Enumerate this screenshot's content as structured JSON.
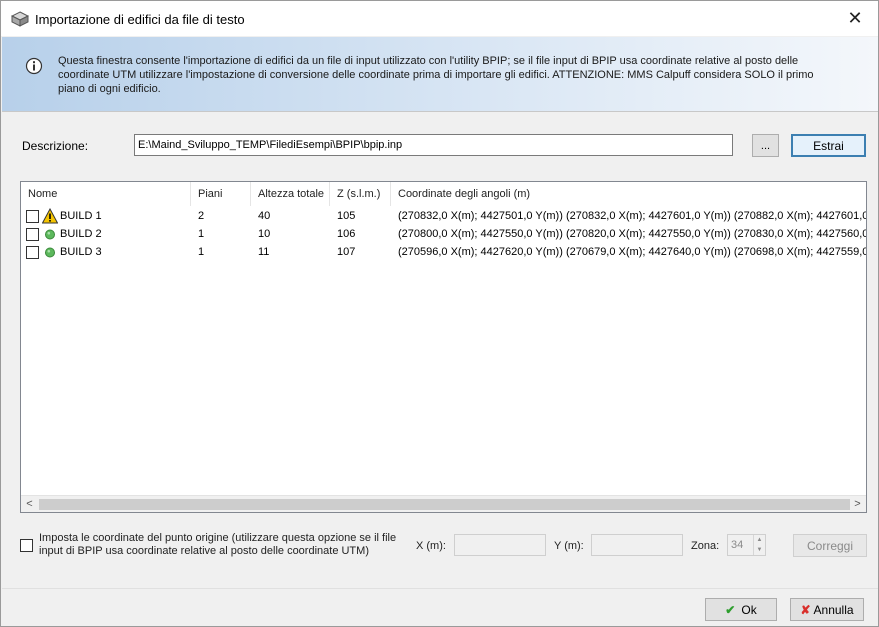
{
  "window": {
    "title": "Importazione di edifici da file di testo",
    "close_glyph": "✕"
  },
  "info": {
    "icon": "info-icon",
    "text": "Questa finestra consente l'importazione di edifici da un file di input utilizzato con l'utility BPIP; se il file input di BPIP usa coordinate relative al posto delle coordinate UTM utilizzare l'impostazione di conversione delle coordinate  prima di importare gli edifici. ATTENZIONE: MMS Calpuff considera SOLO il primo piano di ogni edificio."
  },
  "descrizione": {
    "label": "Descrizione:",
    "value": "E:\\Maind_Sviluppo_TEMP\\FilediEsempi\\BPIP\\bpip.inp",
    "browse_label": "...",
    "extract_label": "Estrai"
  },
  "table": {
    "columns": [
      "Nome",
      "Piani",
      "Altezza totale",
      "Z (s.l.m.)",
      "Coordinate degli angoli (m)"
    ],
    "rows": [
      {
        "name": "BUILD 1",
        "status": "warning",
        "piani": "2",
        "altezza": "40",
        "z": "105",
        "coords": "(270832,0 X(m); 4427501,0 Y(m)) (270832,0 X(m); 4427601,0 Y(m)) (270882,0 X(m); 4427601,0 ..."
      },
      {
        "name": "BUILD 2",
        "status": "ok",
        "piani": "1",
        "altezza": "10",
        "z": "106",
        "coords": "(270800,0 X(m); 4427550,0 Y(m)) (270820,0 X(m); 4427550,0 Y(m)) (270830,0 X(m); 4427560,0 ..."
      },
      {
        "name": "BUILD 3",
        "status": "ok",
        "piani": "1",
        "altezza": "11",
        "z": "107",
        "coords": "(270596,0 X(m); 4427620,0 Y(m)) (270679,0 X(m); 4427640,0 Y(m)) (270698,0 X(m); 4427559,0 ..."
      }
    ],
    "scroll_left": "<",
    "scroll_right": ">"
  },
  "origin": {
    "label": "Imposta le coordinate del punto origine (utilizzare questa opzione se il file input di BPIP usa coordinate relative al posto delle coordinate UTM)",
    "x_label": "X (m):",
    "y_label": "Y (m):",
    "zona_label": "Zona:",
    "zona_value": "34",
    "correggi_label": "Correggi"
  },
  "footer": {
    "ok_label": "Ok",
    "cancel_label": "Annulla"
  },
  "colors": {
    "warning": "#f5c400",
    "ok": "#5cb85c",
    "ok_icon": "#2e9e2e",
    "cancel_icon": "#d9302c"
  }
}
